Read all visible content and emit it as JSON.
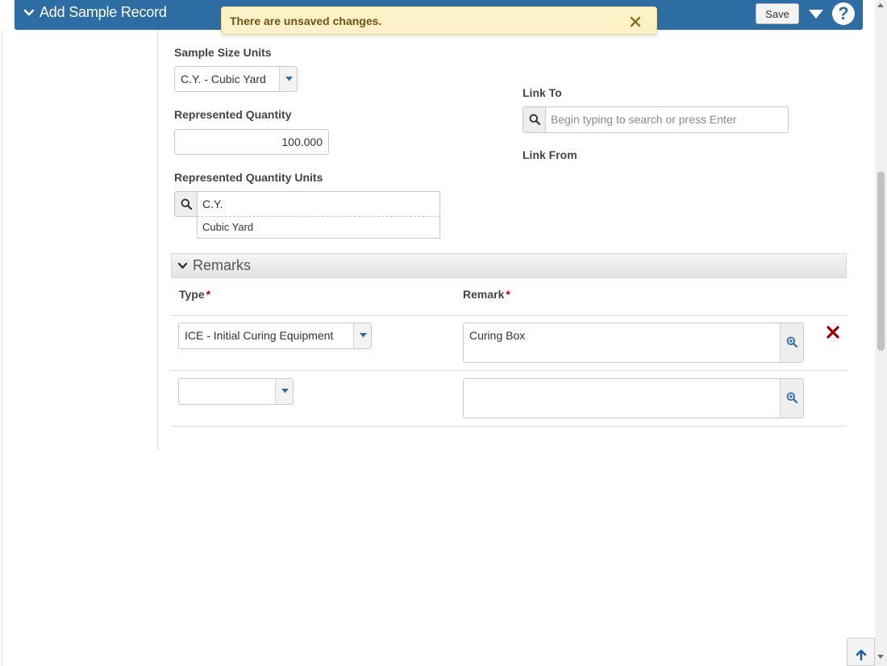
{
  "header": {
    "title": "Add Sample Record",
    "save_label": "Save",
    "help_label": "?"
  },
  "notification": {
    "message": "There are unsaved changes."
  },
  "form": {
    "sample_size_units": {
      "label": "Sample Size Units",
      "value": "C.Y. - Cubic Yard"
    },
    "represented_quantity": {
      "label": "Represented Quantity",
      "value": "100.000"
    },
    "represented_quantity_units": {
      "label": "Represented Quantity Units",
      "value": "C.Y.",
      "suggestion": "Cubic Yard"
    },
    "link_to": {
      "label": "Link To",
      "placeholder": "Begin typing to search or press Enter"
    },
    "link_from": {
      "label": "Link From"
    }
  },
  "remarks": {
    "section_title": "Remarks",
    "columns": {
      "type": "Type",
      "remark": "Remark",
      "required_marker": "*"
    },
    "rows": [
      {
        "type": "ICE - Initial Curing Equipment",
        "remark": "Curing Box"
      },
      {
        "type": "",
        "remark": ""
      }
    ]
  },
  "colors": {
    "header_bg": "#2e6da4",
    "notice_bg": "#fcf1c7",
    "required": "#b20000",
    "delete": "#9b0000"
  },
  "icons": {
    "header_chevron": "chevron-down-icon",
    "notice_close": "close-icon",
    "menu": "caret-down-icon",
    "search": "search-icon",
    "zoom": "zoom-in-icon",
    "delete": "delete-icon",
    "scroll_top": "arrow-up-icon"
  }
}
